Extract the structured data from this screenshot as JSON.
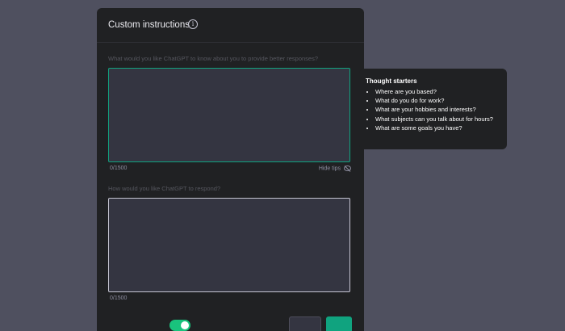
{
  "modal": {
    "title": "Custom instructions",
    "info_icon": "info-icon",
    "about_you": {
      "label": "What would you like ChatGPT to know about you to provide better responses?",
      "value": "",
      "counter": "0/1500",
      "hide_tips_label": "Hide tips",
      "hide_tips_icon": "eye-off-icon"
    },
    "response_style": {
      "label": "How would you like ChatGPT to respond?",
      "value": "",
      "counter": "0/1500"
    },
    "toggle_on": true
  },
  "tooltip": {
    "title": "Thought starters",
    "items": [
      "Where are you based?",
      "What do you do for work?",
      "What are your hobbies and interests?",
      "What subjects can you talk about for hours?",
      "What are some goals you have?"
    ]
  },
  "colors": {
    "backdrop": "#4f505f",
    "modal_bg": "#202123",
    "input_bg": "#343541",
    "accent_green": "#10a37f",
    "toggle_green": "#19c37d"
  }
}
